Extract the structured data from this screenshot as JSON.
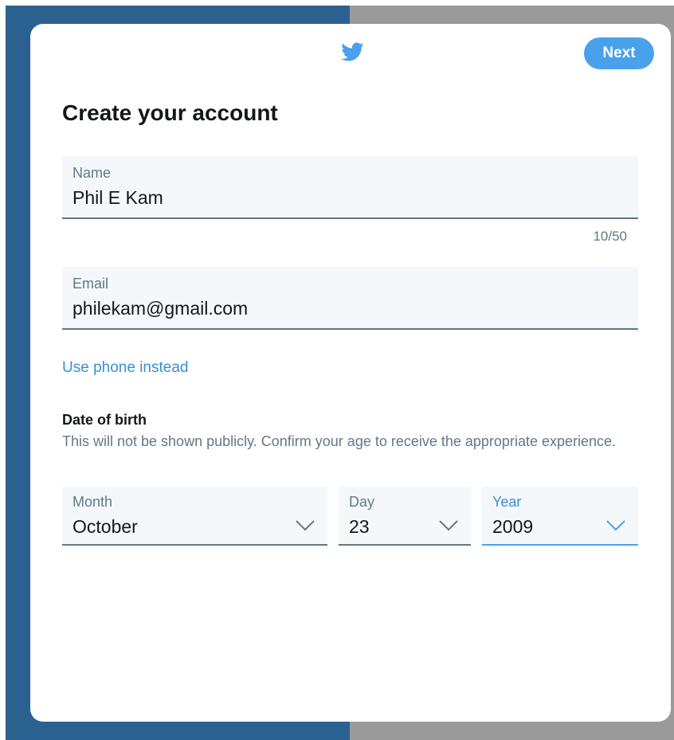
{
  "colors": {
    "accent": "#4aa1eb",
    "link": "#3a8fd1",
    "text": "#14171a",
    "muted": "#657786",
    "field_bg": "#f5f8fa"
  },
  "header": {
    "logo_icon": "twitter-bird-icon",
    "next_label": "Next"
  },
  "title": "Create your account",
  "form": {
    "name": {
      "label": "Name",
      "value": "Phil E Kam",
      "counter": "10/50"
    },
    "email": {
      "label": "Email",
      "value": "philekam@gmail.com"
    },
    "use_phone_link": "Use phone instead"
  },
  "dob": {
    "heading": "Date of birth",
    "description": "This will not be shown publicly. Confirm your age to receive the appropriate experience.",
    "month": {
      "label": "Month",
      "value": "October"
    },
    "day": {
      "label": "Day",
      "value": "23"
    },
    "year": {
      "label": "Year",
      "value": "2009"
    },
    "dropdown_icon": "chevron-down-icon"
  }
}
